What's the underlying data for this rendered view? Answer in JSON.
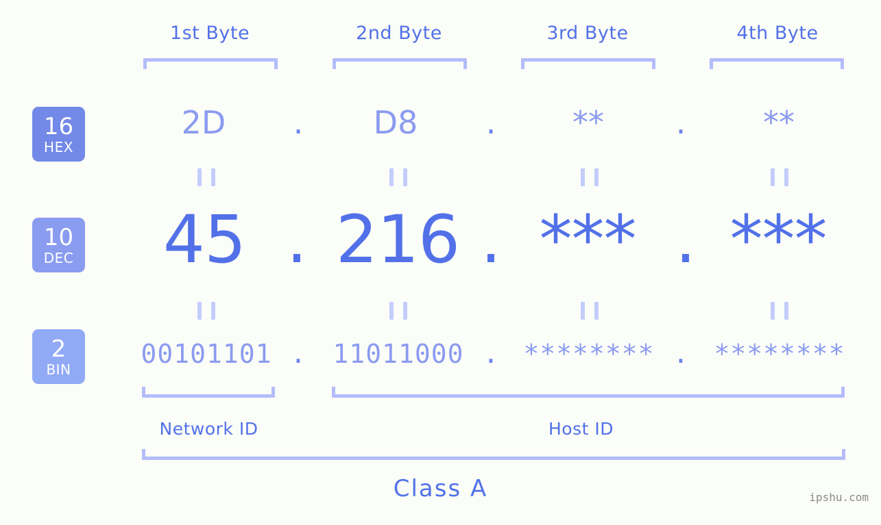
{
  "meta": {
    "background_color": "#fbfdf8",
    "accent_strong": "#5271e8",
    "accent_light": "#8b9bf0",
    "bracket_color": "#b4bdfa",
    "watermark_color": "#8a8a8a"
  },
  "header": {
    "bytes": [
      {
        "label": "1st Byte"
      },
      {
        "label": "2nd Byte"
      },
      {
        "label": "3rd Byte"
      },
      {
        "label": "4th Byte"
      }
    ]
  },
  "radix_badges": [
    {
      "number": "16",
      "name": "HEX",
      "color": "#7289e8"
    },
    {
      "number": "10",
      "name": "DEC",
      "color": "#8a9cf0"
    },
    {
      "number": "2",
      "name": "BIN",
      "color": "#91aaf6"
    }
  ],
  "rows": {
    "hex": {
      "values": [
        "2D",
        "D8",
        "**",
        "**"
      ],
      "separator": "."
    },
    "dec": {
      "values": [
        "45",
        "216",
        "***",
        "***"
      ],
      "separator": "."
    },
    "bin": {
      "values": [
        "00101101",
        "11011000",
        "********",
        "********"
      ],
      "separator": "."
    }
  },
  "equality_mark": "||",
  "footer": {
    "network_id_label": "Network ID",
    "host_id_label": "Host ID",
    "class_label": "Class A"
  },
  "watermark": "ipshu.com"
}
